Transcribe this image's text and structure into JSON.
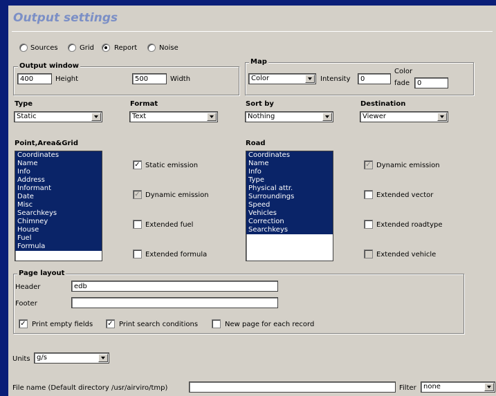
{
  "title": "Output settings",
  "mode_radios": [
    {
      "label": "Sources",
      "selected": false
    },
    {
      "label": "Grid",
      "selected": false
    },
    {
      "label": "Report",
      "selected": true
    },
    {
      "label": "Noise",
      "selected": false
    }
  ],
  "output_window": {
    "title": "Output window",
    "height_value": "400",
    "height_label": "Height",
    "width_value": "500",
    "width_label": "Width"
  },
  "map": {
    "title": "Map",
    "color_select": "Color",
    "intensity_label": "Intensity",
    "intensity_value": "0",
    "color_fade_label_1": "Color",
    "color_fade_label_2": "fade",
    "color_fade_value": "0"
  },
  "type": {
    "label": "Type",
    "value": "Static"
  },
  "format": {
    "label": "Format",
    "value": "Text"
  },
  "sort_by": {
    "label": "Sort by",
    "value": "Nothing"
  },
  "destination": {
    "label": "Destination",
    "value": "Viewer"
  },
  "point_area_grid": {
    "title": "Point,Area&Grid",
    "items": [
      "Coordinates",
      "Name",
      "Info",
      "Address",
      "Informant",
      "Date",
      "Misc",
      "Searchkeys",
      "Chimney",
      "House",
      "Fuel",
      "Formula"
    ]
  },
  "point_checks": [
    {
      "label": "Static emission",
      "checked": true,
      "disabled": false
    },
    {
      "label": "Dynamic emission",
      "checked": true,
      "disabled": true
    },
    {
      "label": "Extended fuel",
      "checked": false,
      "disabled": false
    },
    {
      "label": "Extended formula",
      "checked": false,
      "disabled": false
    }
  ],
  "road": {
    "title": "Road",
    "items": [
      "Coordinates",
      "Name",
      "Info",
      "Type",
      "Physical attr.",
      "Surroundings",
      "Speed",
      "Vehicles",
      "Correction",
      "Searchkeys"
    ]
  },
  "road_checks": [
    {
      "label": "Dynamic emission",
      "checked": true,
      "disabled": true
    },
    {
      "label": "Extended vector",
      "checked": false,
      "disabled": false
    },
    {
      "label": "Extended roadtype",
      "checked": false,
      "disabled": false
    },
    {
      "label": "Extended vehicle",
      "checked": false,
      "disabled": true
    }
  ],
  "page_layout": {
    "title": "Page layout",
    "header_label": "Header",
    "header_value": "edb",
    "footer_label": "Footer",
    "footer_value": "",
    "print_empty_fields": "Print empty fields",
    "print_search_conditions": "Print search conditions",
    "new_page_each_record": "New page for each record"
  },
  "units": {
    "label": "Units",
    "value": "g/s"
  },
  "file_name": {
    "label": "File name (Default directory /usr/airviro/tmp)",
    "value": ""
  },
  "filter": {
    "label": "Filter",
    "value": "none"
  }
}
